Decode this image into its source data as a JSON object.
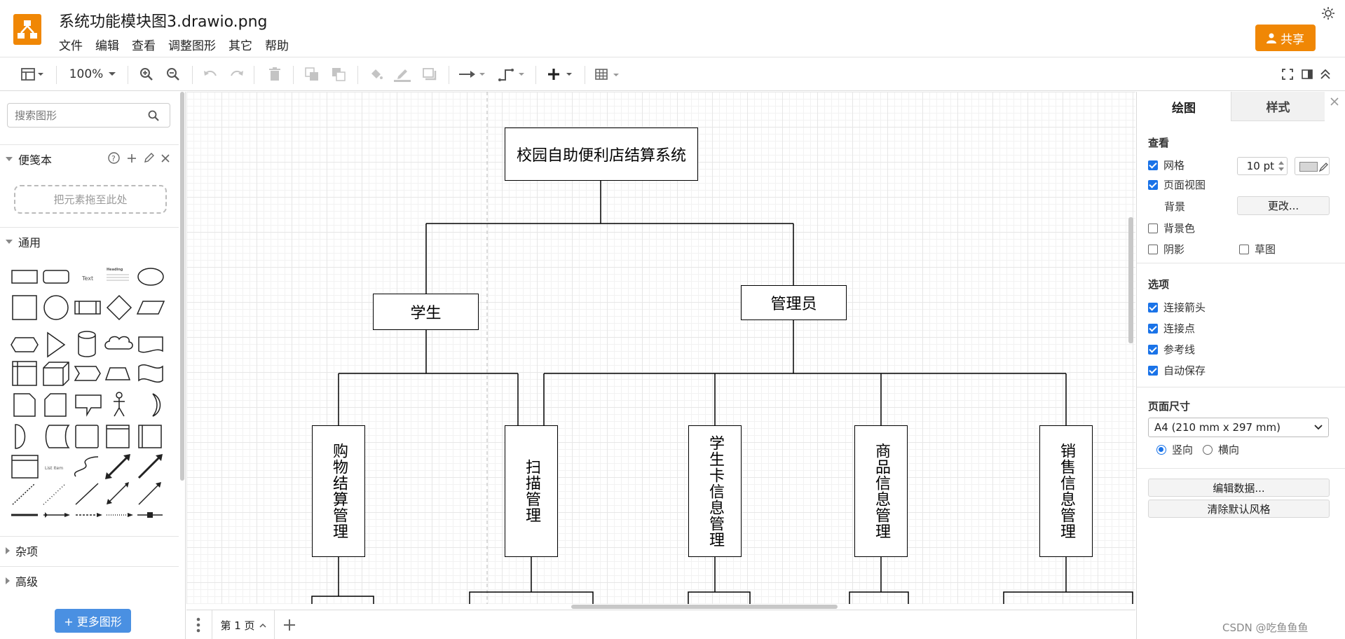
{
  "app": {
    "doc_title": "系统功能模块图3.drawio.png",
    "menu": [
      "文件",
      "编辑",
      "查看",
      "调整图形",
      "其它",
      "帮助"
    ],
    "share_label": "共享",
    "accent": "#f08705"
  },
  "toolbar": {
    "zoom": "100%"
  },
  "sidebar": {
    "search_placeholder": "搜索图形",
    "scratchpad_title": "便笺本",
    "drop_hint": "把元素拖至此处",
    "general_title": "通用",
    "misc_title": "杂项",
    "advanced_title": "高级",
    "more_shapes": "+ 更多图形",
    "shape_text_label": "Text",
    "shape_heading_label": "Heading",
    "shape_list_label": "List Item"
  },
  "diagram": {
    "root": "校园自助便利店结算系统",
    "student": "学生",
    "admin": "管理员",
    "modules": [
      "购物结算管理",
      "扫描管理",
      "学生卡信息管理",
      "商品信息管理",
      "销售信息管理"
    ]
  },
  "pages": {
    "current": "第 1 页"
  },
  "panel": {
    "tab_draw": "绘图",
    "tab_style": "样式",
    "view_heading": "查看",
    "grid_label": "网格",
    "grid_size": "10 pt",
    "page_view_label": "页面视图",
    "background_label": "背景",
    "change_button": "更改...",
    "bg_color_label": "背景色",
    "shadow_label": "阴影",
    "sketch_label": "草图",
    "options_heading": "选项",
    "connect_arrows": "连接箭头",
    "connect_points": "连接点",
    "guides": "参考线",
    "autosave": "自动保存",
    "page_size_heading": "页面尺寸",
    "paper_size": "A4 (210 mm x 297 mm)",
    "portrait": "竖向",
    "landscape": "横向",
    "edit_data": "编辑数据...",
    "clear_style": "清除默认风格"
  },
  "watermark": "CSDN @吃鱼鱼鱼"
}
